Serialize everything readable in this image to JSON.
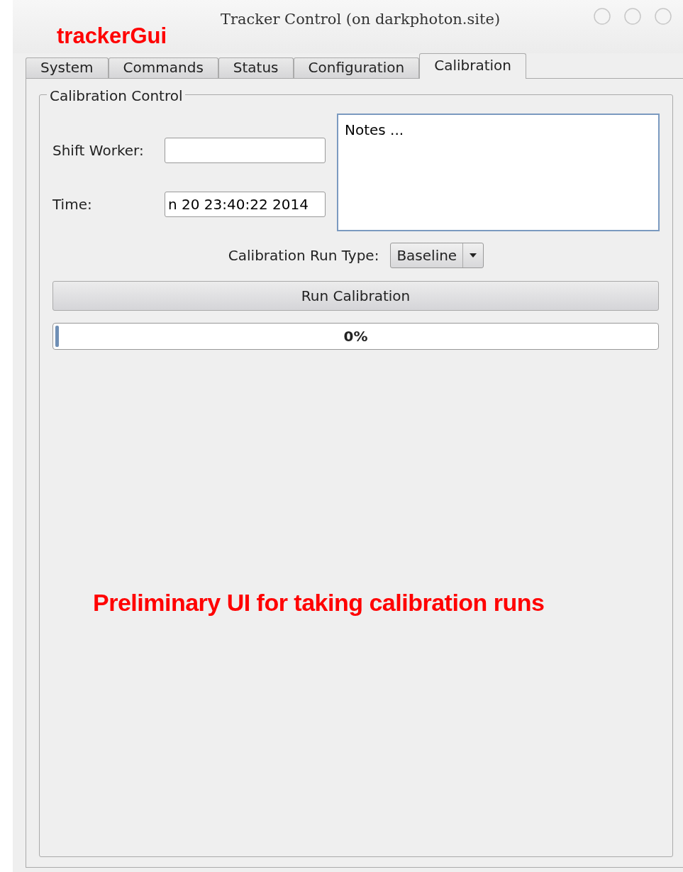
{
  "window": {
    "title": "Tracker Control (on darkphoton.site)"
  },
  "annotations": [
    {
      "kind": "heading",
      "text": "trackerGui"
    },
    {
      "kind": "caption",
      "text": "Preliminary UI for taking calibration runs"
    }
  ],
  "tabs": [
    {
      "label": "System",
      "selected": false
    },
    {
      "label": "Commands",
      "selected": false
    },
    {
      "label": "Status",
      "selected": false
    },
    {
      "label": "Configuration",
      "selected": false
    },
    {
      "label": "Calibration",
      "selected": true
    }
  ],
  "group": {
    "title": "Calibration Control",
    "fields": [
      {
        "label": "Shift Worker:"
      },
      {
        "label": "Time:",
        "value": "n 20 23:40:22 2014"
      }
    ],
    "notes": {
      "value": "Notes ..."
    },
    "run_type": {
      "label": "Calibration Run Type:",
      "value": "Baseline"
    },
    "button": "Run Calibration",
    "progress": {
      "level": 0,
      "reading": "0%"
    }
  }
}
